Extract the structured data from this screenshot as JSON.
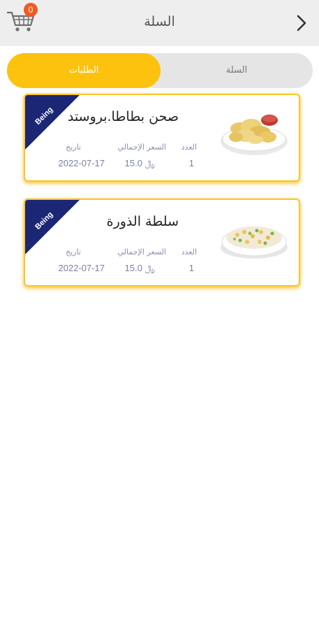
{
  "header": {
    "title": "السلة",
    "cart_count": "0",
    "cart_icon": "cart-icon",
    "back_icon": "chevron-right-icon"
  },
  "tabs": [
    {
      "label": "الطلبات",
      "active": true
    },
    {
      "label": "السلة",
      "active": false
    }
  ],
  "labels": {
    "quantity": "العدد",
    "total_price": "السعر الإجمالي",
    "date": "تاريخ"
  },
  "orders": [
    {
      "name": "صحن بطاطا.بروستد",
      "status": "Being",
      "quantity": "1",
      "total": "15.0 ﷼",
      "date": "2022-07-17",
      "image": "potato-chips-plate"
    },
    {
      "name": "سلطة الذورة",
      "status": "Being",
      "quantity": "1",
      "total": "15.0 ﷼",
      "date": "2022-07-17",
      "image": "corn-salad-plate"
    }
  ],
  "colors": {
    "accent": "#fdc20d",
    "ribbon": "#1b2775",
    "badge": "#f15a24",
    "header_bg": "#eeeeee"
  }
}
